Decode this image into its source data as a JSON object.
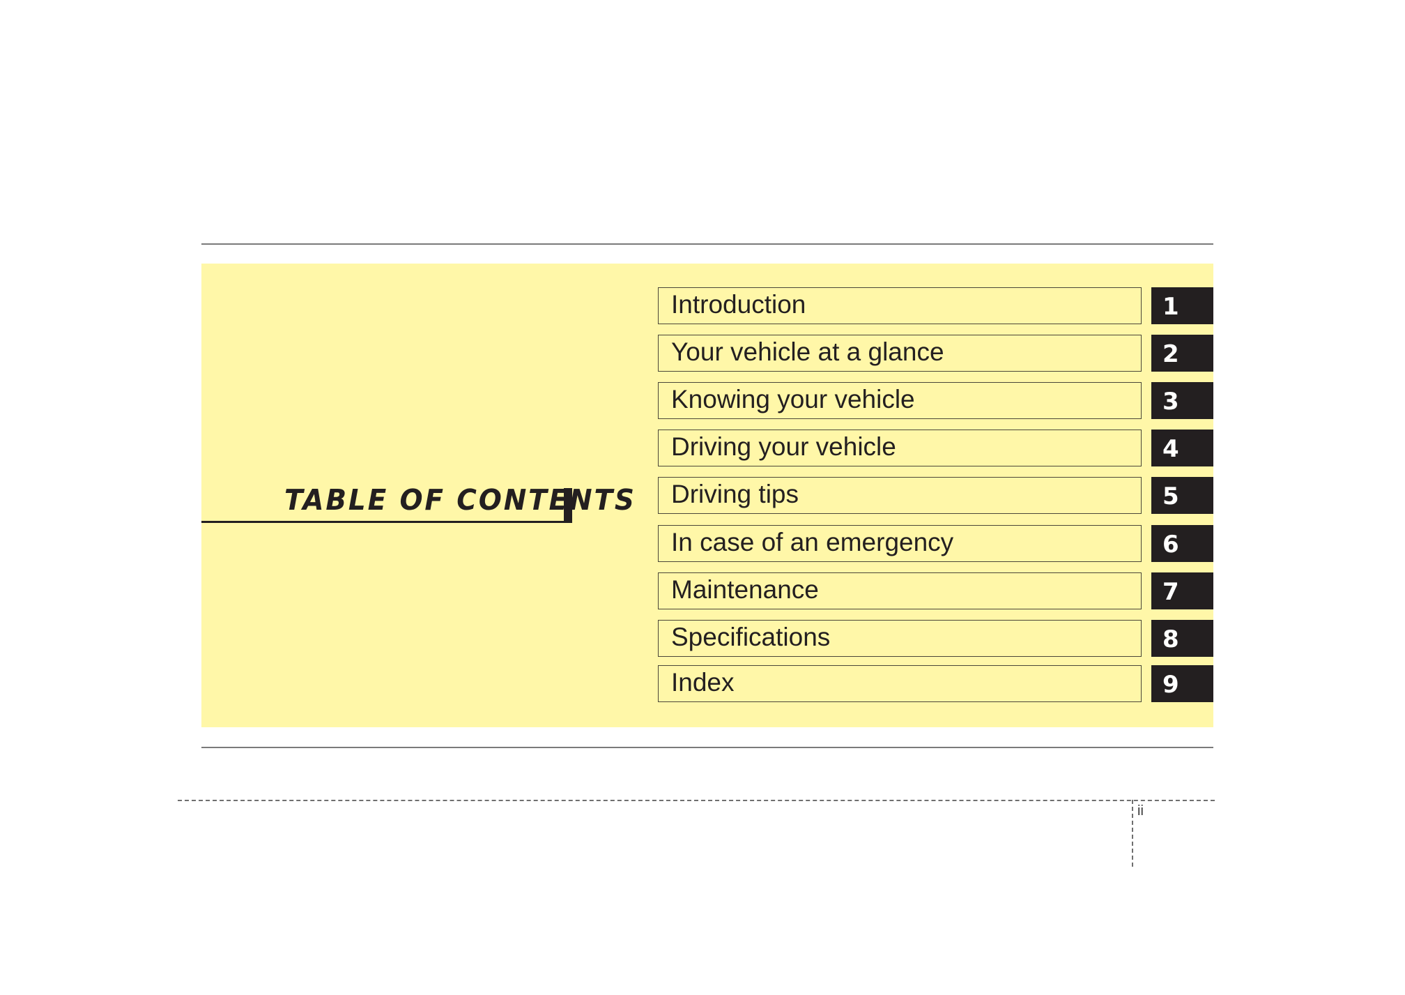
{
  "heading": {
    "title": "TABLE OF CONTENTS"
  },
  "colors": {
    "panel": "#fff7a8",
    "ink": "#231f20",
    "number_text": "#ffffff"
  },
  "chapters": [
    {
      "label": "Introduction",
      "number": "1"
    },
    {
      "label": "Your vehicle at a glance",
      "number": "2"
    },
    {
      "label": "Knowing your vehicle",
      "number": "3"
    },
    {
      "label": "Driving your vehicle",
      "number": "4"
    },
    {
      "label": "Driving tips",
      "number": "5"
    },
    {
      "label": "In case of an emergency",
      "number": "6"
    },
    {
      "label": "Maintenance",
      "number": "7"
    },
    {
      "label": "Specifications",
      "number": "8"
    },
    {
      "label": "Index",
      "number": "9"
    }
  ],
  "footer": {
    "page_number": "ii"
  }
}
